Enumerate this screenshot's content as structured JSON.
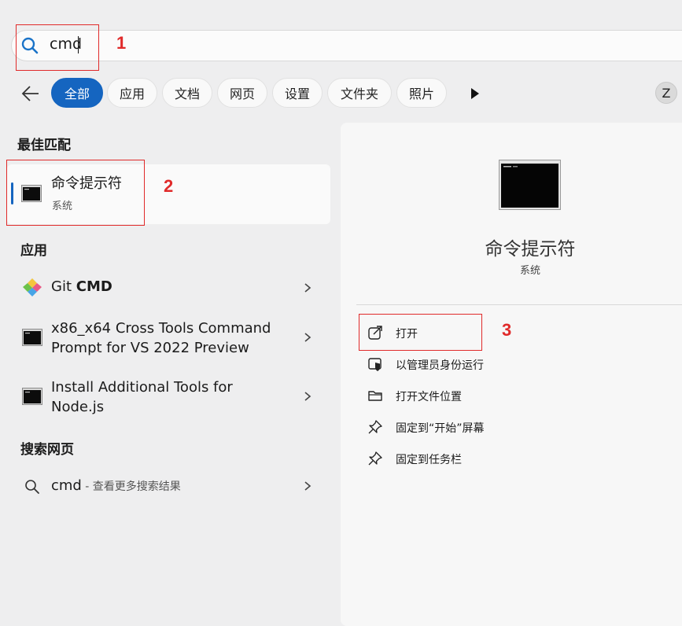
{
  "search": {
    "query": "cmd"
  },
  "annotations": [
    "1",
    "2",
    "3"
  ],
  "filters": {
    "items": [
      "全部",
      "应用",
      "文档",
      "网页",
      "设置",
      "文件夹",
      "照片"
    ],
    "avatar_letter": "Z"
  },
  "best_match": {
    "section": "最佳匹配",
    "title": "命令提示符",
    "subtitle": "系统"
  },
  "apps": {
    "section": "应用",
    "git_cmd": {
      "prefix": "Git ",
      "bold": "CMD"
    },
    "x86_line1": "x86_x64 Cross Tools Command",
    "x86_line2": "Prompt for VS 2022 Preview",
    "node_line1": "Install Additional Tools for",
    "node_line2": "Node.js"
  },
  "web": {
    "section": "搜索网页",
    "query": "cmd",
    "suffix": " - 查看更多搜索结果"
  },
  "detail": {
    "title": "命令提示符",
    "subtitle": "系统",
    "actions": [
      "打开",
      "以管理员身份运行",
      "打开文件位置",
      "固定到“开始”屏幕",
      "固定到任务栏"
    ]
  },
  "colors": {
    "accent": "#1565c0",
    "annotation": "#e02a2a",
    "background": "#eeeeef"
  },
  "icons": [
    "search-icon",
    "back-arrow-icon",
    "play-icon",
    "cmd-icon",
    "git-icon",
    "chevron-right-icon",
    "open-external-icon",
    "shield-icon",
    "folder-icon",
    "pin-icon"
  ]
}
